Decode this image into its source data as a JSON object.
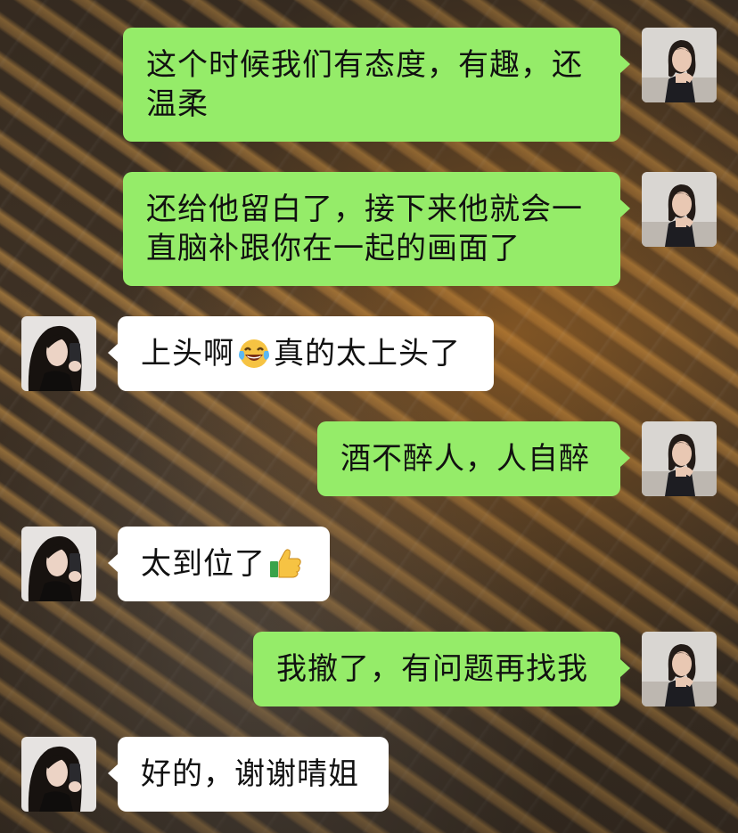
{
  "messages": [
    {
      "side": "out",
      "text_line1": "这个时候我们有态度，有趣，还",
      "text_line2": "温柔"
    },
    {
      "side": "out",
      "text_line1": "还给他留白了，接下来他就会一",
      "text_line2": "直脑补跟你在一起的画面了"
    },
    {
      "side": "in",
      "text_before": "上头啊",
      "emoji": "laughing-tears-emoji",
      "text_after": "真的太上头了"
    },
    {
      "side": "out",
      "text": "酒不醉人，人自醉"
    },
    {
      "side": "in",
      "text": "太到位了",
      "emoji": "thumbs-up-emoji"
    },
    {
      "side": "out",
      "text": "我撤了，有问题再找我"
    },
    {
      "side": "in",
      "text": "好的，谢谢晴姐"
    }
  ],
  "colors": {
    "outgoing_bubble": "#95ec69",
    "incoming_bubble": "#ffffff"
  }
}
